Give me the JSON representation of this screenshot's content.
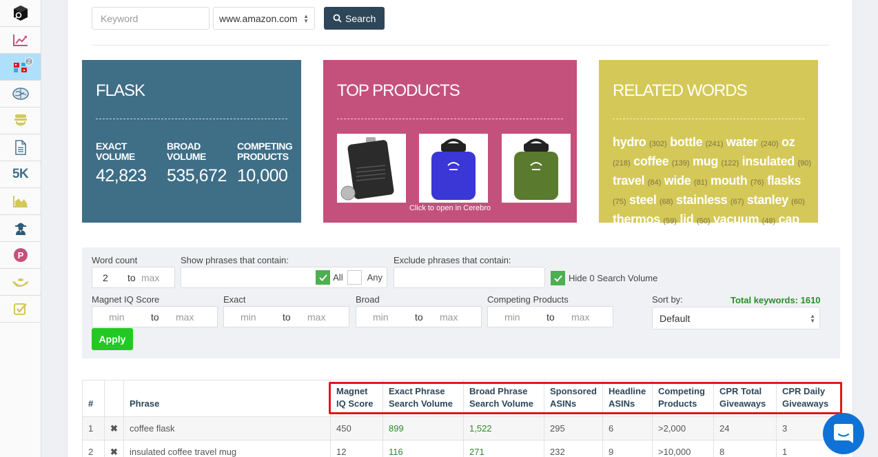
{
  "sidebar": {
    "items": [
      {
        "icon": "product-research-cube-icon",
        "label": ""
      },
      {
        "icon": "trend-chart-icon",
        "label": ""
      },
      {
        "icon": "keyword-connect-icon",
        "badge": "2",
        "active": true
      },
      {
        "icon": "brain-icon",
        "label": ""
      },
      {
        "icon": "frankenstein-icon",
        "label": ""
      },
      {
        "icon": "document-icon",
        "label": ""
      },
      {
        "icon": "5k-icon",
        "label": "5K"
      },
      {
        "icon": "area-chart-icon",
        "label": ""
      },
      {
        "icon": "spy-icon",
        "label": ""
      },
      {
        "icon": "p-circle-icon",
        "label": "P"
      },
      {
        "icon": "genie-lamp-icon",
        "label": ""
      },
      {
        "icon": "checkbox-icon",
        "label": ""
      }
    ]
  },
  "search": {
    "keyword_placeholder": "Keyword",
    "keyword_value": "",
    "marketplace": "www.amazon.com",
    "button_label": "Search"
  },
  "cards": {
    "keyword": {
      "title": "FLASK",
      "stats": [
        {
          "label_line1": "EXACT",
          "label_line2": "VOLUME",
          "value": "42,823"
        },
        {
          "label_line1": "BROAD",
          "label_line2": "VOLUME",
          "value": "535,672"
        },
        {
          "label_line1": "COMPETING",
          "label_line2": "PRODUCTS",
          "value": "10,000"
        }
      ]
    },
    "top_products": {
      "title": "TOP PRODUCTS",
      "products": [
        {
          "name": "leather hip flask",
          "color": "#2b2b2b"
        },
        {
          "name": "blue insulated bottle",
          "color": "#3b36d6"
        },
        {
          "name": "olive insulated bottle",
          "color": "#5a7a2e"
        }
      ],
      "caption": "Click to open in Cerebro"
    },
    "related_words": {
      "title": "RELATED WORDS",
      "words": [
        {
          "word": "hydro",
          "count": "(302)"
        },
        {
          "word": "bottle",
          "count": "(241)"
        },
        {
          "word": "water",
          "count": "(240)"
        },
        {
          "word": "oz",
          "count": "(218)"
        },
        {
          "word": "coffee",
          "count": "(139)"
        },
        {
          "word": "mug",
          "count": "(122)"
        },
        {
          "word": "insulated",
          "count": "(90)"
        },
        {
          "word": "travel",
          "count": "(84)"
        },
        {
          "word": "wide",
          "count": "(81)"
        },
        {
          "word": "mouth",
          "count": "(76)"
        },
        {
          "word": "flasks",
          "count": "(75)"
        },
        {
          "word": "steel",
          "count": "(68)"
        },
        {
          "word": "stainless",
          "count": "(67)"
        },
        {
          "word": "stanley",
          "count": "(60)"
        },
        {
          "word": "thermos",
          "count": "(59)"
        },
        {
          "word": "lid",
          "count": "(50)"
        },
        {
          "word": "vacuum",
          "count": "(48)"
        },
        {
          "word": "cap",
          "count": ""
        }
      ]
    }
  },
  "filters": {
    "word_count": {
      "label": "Word count",
      "min_value": "2",
      "to": "to",
      "max_placeholder": "max"
    },
    "show_phrases": {
      "label": "Show phrases that contain:",
      "value": "",
      "all_label": "All",
      "all_checked": true,
      "any_label": "Any",
      "any_checked": false
    },
    "exclude_phrases": {
      "label": "Exclude phrases that contain:",
      "value": ""
    },
    "hide_zero": {
      "label": "Hide 0 Search Volume",
      "checked": true
    },
    "magnet_iq": {
      "label": "Magnet IQ Score",
      "min_placeholder": "min",
      "to": "to",
      "max_placeholder": "max"
    },
    "exact": {
      "label": "Exact",
      "min_placeholder": "min",
      "to": "to",
      "max_placeholder": "max"
    },
    "broad": {
      "label": "Broad",
      "min_placeholder": "min",
      "to": "to",
      "max_placeholder": "max"
    },
    "competing": {
      "label": "Competing Products",
      "min_placeholder": "min",
      "to": "to",
      "max_placeholder": "max"
    },
    "sort": {
      "label": "Sort by:",
      "value": "Default"
    },
    "total_keywords": "Total keywords: 1610",
    "apply_label": "Apply"
  },
  "table": {
    "headers": [
      {
        "line1": "#",
        "line2": ""
      },
      {
        "line1": "",
        "line2": ""
      },
      {
        "line1": "Phrase",
        "line2": ""
      },
      {
        "line1": "Magnet",
        "line2": "IQ Score"
      },
      {
        "line1": "Exact Phrase",
        "line2": "Search Volume"
      },
      {
        "line1": "Broad Phrase",
        "line2": "Search Volume"
      },
      {
        "line1": "Sponsored",
        "line2": "ASINs"
      },
      {
        "line1": "Headline",
        "line2": "ASINs"
      },
      {
        "line1": "Competing",
        "line2": "Products"
      },
      {
        "line1": "CPR Total",
        "line2": "Giveaways"
      },
      {
        "line1": "CPR Daily",
        "line2": "Giveaways"
      }
    ],
    "rows": [
      {
        "num": "1",
        "phrase": "coffee flask",
        "magnet_iq": "450",
        "exact": "899",
        "broad": "1,522",
        "sponsored": "295",
        "headline": "6",
        "competing": ">2,000",
        "cpr_total": "24",
        "cpr_daily": "3"
      },
      {
        "num": "2",
        "phrase": "insulated coffee travel mug",
        "magnet_iq": "12",
        "exact": "116",
        "broad": "271",
        "sponsored": "232",
        "headline": "9",
        "competing": ">10,000",
        "cpr_total": "8",
        "cpr_daily": "1"
      }
    ]
  },
  "colors": {
    "keyword_card": "#3f6e87",
    "products_card": "#c4517c",
    "related_card": "#d4c858",
    "search_button": "#2d4659",
    "apply_button": "#22c922",
    "highlight": "#e3151a",
    "chat": "#0f72d6",
    "positive": "#2a8c2a"
  }
}
